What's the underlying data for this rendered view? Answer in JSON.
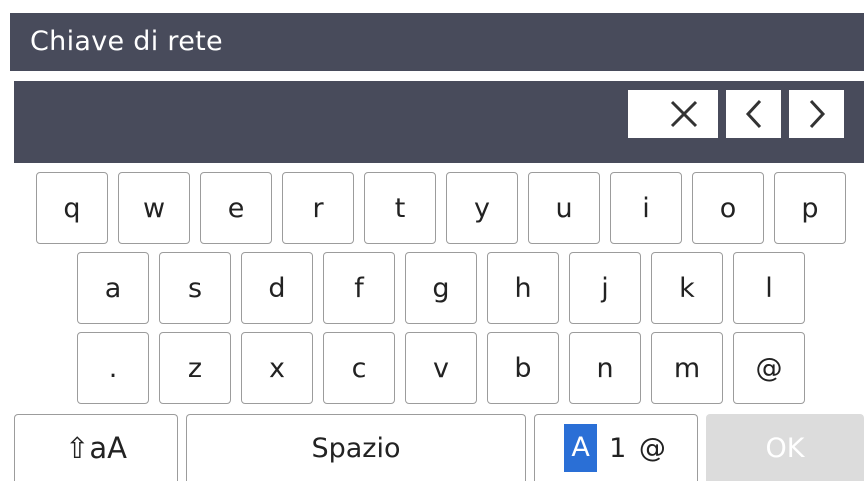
{
  "header": {
    "title": "Chiave di rete"
  },
  "input": {
    "value": ""
  },
  "keyboard": {
    "row1": [
      "q",
      "w",
      "e",
      "r",
      "t",
      "y",
      "u",
      "i",
      "o",
      "p"
    ],
    "row2": [
      "a",
      "s",
      "d",
      "f",
      "g",
      "h",
      "j",
      "k",
      "l"
    ],
    "row3": [
      ".",
      "z",
      "x",
      "c",
      "v",
      "b",
      "n",
      "m",
      "@"
    ],
    "bottom": {
      "shift_label": "⇧aA",
      "space_label": "Spazio",
      "mode_active": "A",
      "mode_rest": "1 @",
      "ok_label": "OK"
    }
  },
  "colors": {
    "header_bg": "#484b5b",
    "mode_active_bg": "#2a6fd6",
    "ok_disabled_bg": "#dcdcdc"
  }
}
